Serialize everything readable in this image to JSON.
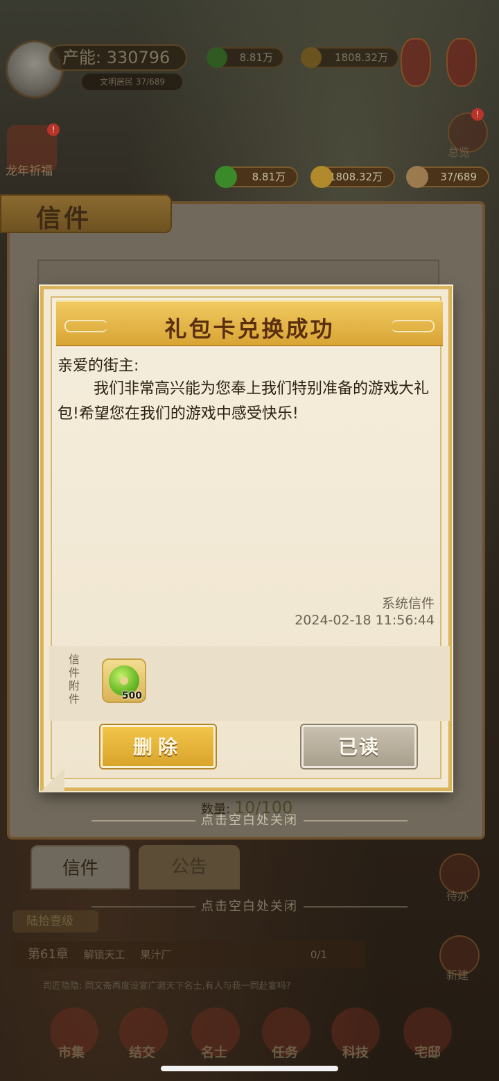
{
  "background": {
    "production": "产能: 330796",
    "citizens": "文明居民 37/689",
    "top_jade": "8.81万",
    "top_coins": "1808.32万",
    "dragon_event": "龙年祈福",
    "overview": "总览",
    "pending": "待办",
    "build": "新建"
  },
  "mail_window": {
    "title": "信件",
    "resources": {
      "jade": "8.81万",
      "coins": "1808.32万",
      "population": "37/689"
    },
    "count_label": "数量:",
    "count_value": "10/100",
    "tabs": [
      "信件",
      "公告"
    ],
    "close_hint": "点击空白处关闭"
  },
  "dialog": {
    "title": "礼包卡兑换成功",
    "greeting": "亲爱的街主:",
    "body": "我们非常高兴能为您奉上我们特别准备的游戏大礼包!希望您在我们的游戏中感受快乐!",
    "sender": "系统信件",
    "timestamp": "2024-02-18  11:56:44",
    "attachment_label": "信件附件",
    "attachment": {
      "icon": "jade-coin-icon",
      "quantity": "500"
    },
    "delete_label": "删除",
    "read_label": "已读"
  },
  "outer_close_hint": "点击空白处关闭",
  "hud": {
    "chapter_tag": "陆拾壹级",
    "chapter": "第61章",
    "task": "解锁天工",
    "task_target": "果汁厂",
    "progress": "0/1",
    "ticker": "司匠隐隐: 同文斋再度设宴广邀天下名士,有人与我一同赴宴吗?",
    "nav": [
      "市集",
      "结交",
      "名士",
      "任务",
      "科技",
      "宅邸"
    ]
  },
  "colors": {
    "banner": "#d9a535",
    "delete_button": "#e0ae34",
    "read_button": "#b8ae9c",
    "dialog_bg": "#f2ead7"
  }
}
